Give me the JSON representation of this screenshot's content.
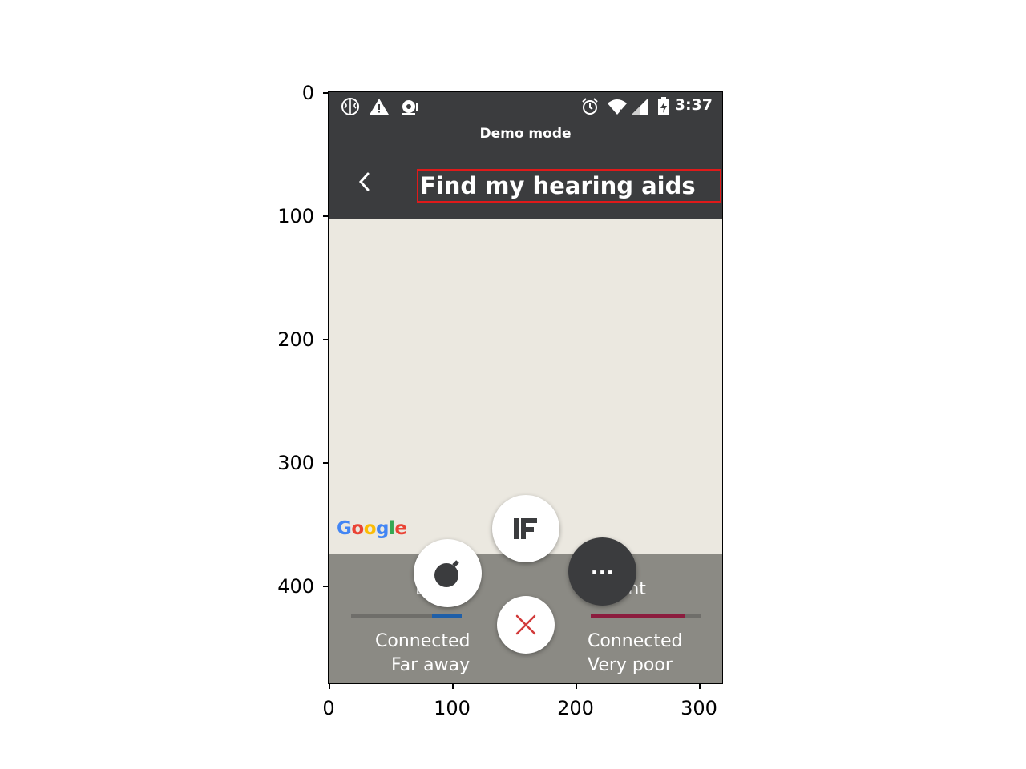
{
  "axes": {
    "y_ticks": [
      "0",
      "100",
      "200",
      "300",
      "400"
    ],
    "x_ticks": [
      "0",
      "100",
      "200",
      "300"
    ]
  },
  "status_bar": {
    "time": "3:37",
    "icons": [
      "brain-icon",
      "warning-icon",
      "notification-icon",
      "alarm-icon",
      "wifi-icon",
      "signal-icon",
      "battery-charging-icon"
    ]
  },
  "banner": {
    "text": "Demo mode"
  },
  "header": {
    "back_icon": "chevron-left-icon",
    "title": "Find my hearing aids"
  },
  "map": {
    "logo": "Google"
  },
  "devices": {
    "left": {
      "label": "Left",
      "status": "Connected",
      "signal": "Far away",
      "level": 0.27,
      "color": "#1f5fa8"
    },
    "right": {
      "label": "Right",
      "status": "Connected",
      "signal": "Very poor",
      "level": 0.85,
      "color": "#8c1c3e"
    }
  },
  "fab_menu": {
    "items": [
      "bomb-icon",
      "ifttt-icon",
      "close-icon",
      "more-icon"
    ],
    "more_label": "...",
    "accent": "#d23a3a"
  }
}
